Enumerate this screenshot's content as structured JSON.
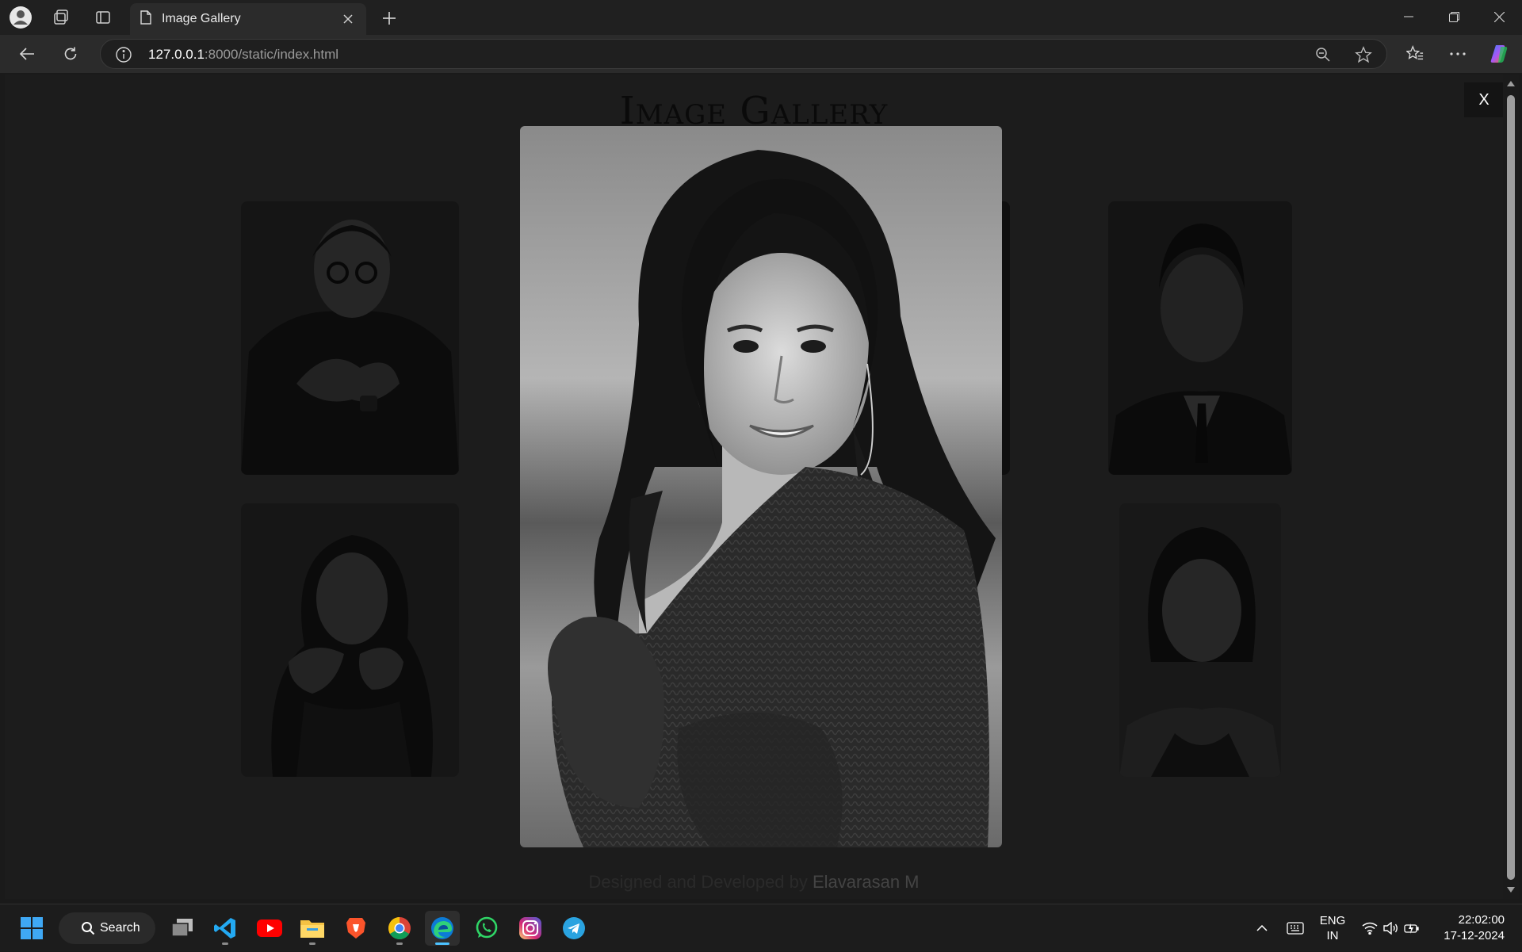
{
  "browser": {
    "tab_title": "Image Gallery",
    "url_host": "127.0.0.1",
    "url_rest": ":8000/static/index.html"
  },
  "page": {
    "title": "Image Gallery",
    "footer_prefix": "Designed and Developed by ",
    "footer_author": "Elavarasan M",
    "close_label": "X"
  },
  "gallery": {
    "thumbnails": [
      "portrait-man-glasses",
      "portrait-woman-hands-face",
      "portrait-man-suit",
      "portrait-woman-dark-hair"
    ],
    "modal_image": "portrait-woman-sweater"
  },
  "taskbar": {
    "search_label": "Search",
    "apps": [
      "file-explorer-stack",
      "vscode",
      "youtube",
      "file-explorer",
      "brave",
      "chrome",
      "edge",
      "whatsapp",
      "instagram",
      "telegram"
    ],
    "lang_line1": "ENG",
    "lang_line2": "IN",
    "time": "22:02:00",
    "date": "17-12-2024"
  },
  "colors": {
    "accent": "#4cc2ff",
    "titlebar": "#202020",
    "overlay": "#1c1c1c"
  }
}
